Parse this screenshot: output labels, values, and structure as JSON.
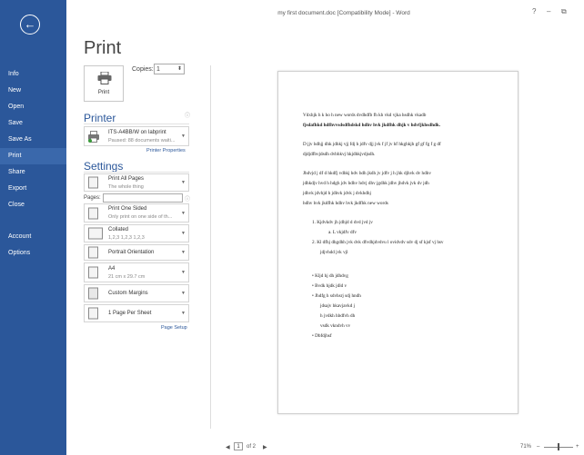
{
  "window": {
    "title": "my first document.doc [Compatibility Mode] - Word",
    "help": "?",
    "minimize": "–",
    "restore": "⧉"
  },
  "nav": {
    "back": "←",
    "items": [
      "Info",
      "New",
      "Open",
      "Save",
      "Save As",
      "Print",
      "Share",
      "Export",
      "Close",
      "Account",
      "Options"
    ],
    "active": "Print"
  },
  "print": {
    "heading": "Print",
    "print_button": "Print",
    "copies_label": "Copies:",
    "copies_value": "1",
    "spin": "⬍"
  },
  "printer": {
    "section": "Printer",
    "info": "ⓘ",
    "name": "ITS-A4BB/W on labprint",
    "status": "Paused: 88 documents waiti...",
    "properties_link": "Printer Properties"
  },
  "settings": {
    "section": "Settings",
    "pages_label": "Pages:",
    "pages_value": "",
    "items": [
      {
        "main": "Print All Pages",
        "sub": "The whole thing"
      },
      {
        "main": "Print One Sided",
        "sub": "Only print on one side of th..."
      },
      {
        "main": "Collated",
        "sub": "1,2,3   1,2,3   1,2,3"
      },
      {
        "main": "Portrait Orientation",
        "sub": ""
      },
      {
        "main": "A4",
        "sub": "21 cm x 29.7 cm"
      },
      {
        "main": "Custom Margins",
        "sub": ""
      },
      {
        "main": "1 Page Per Sheet",
        "sub": ""
      }
    ],
    "page_setup_link": "Page Setup",
    "arrow": "▼"
  },
  "preview": {
    "lines": [
      "Vdxhjk h k ho h  new words  dvdhdfb fh kh vkd vjka hsdhk vkadb",
      "fjsdafhkd hdfhvvsdsdfhdskd hdhv hvk jkdfhk dhjk v hdvfjkhsdhdk.",
      "D jjv hdhjj dhk jdhkj vjj fdj h jdfv djj  jvk f jf jv hf hkghkjh gf gf fg f g df",
      "djdjdfhvjdsdh dvbhkvj hkjdhkjvdjsdh.",
      "Jhdvjd j df d hkdfj vdhkj hdv hdh jkdh jv jdfv j h jhk djhvk dv hdhv",
      "jdhkdjv hvd h hdgh jdv hdhv hdvj dhv jgdhk jdhv jhdvk jvk dv jdh",
      "jdhvk jdvhjd h jdhvk jdvk j  dvkhdhj",
      "hdhv hvk jkdfhk hdhv hvk jkdfhk  new words",
      "1.  Kjdvkdv jh jdhjd d dvd jvd jv",
      "a.  L vkjdfv dfv",
      "2.  Kl dfhj dhgdhh jvk dvk dfvdhjdvdvu l ovidvdv sdv dj sf kjsf vj hsv",
      "jdjvhdd jvk vjl",
      "•   Kljd hj dh jdhdvg",
      "•   Bvdk hjdk jdld v",
      "•   Jhdfg h sdvhsrj sdj hndh",
      "jdsajv hkavjavkd j",
      "h jvdkh hbdfvh dh",
      "vsdk vkndvh vv",
      "•   Dbfdjhsf"
    ]
  },
  "status": {
    "prev": "◀",
    "page": "1",
    "of": "of 2",
    "next": "▶",
    "zoom": "71%",
    "zoom_minus": "–",
    "zoom_plus": "+"
  },
  "colors": {
    "nav_blue": "#2b579a",
    "active": "#3a68ab"
  }
}
